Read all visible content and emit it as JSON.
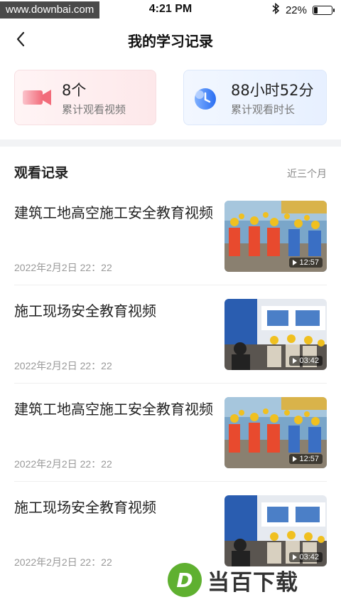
{
  "status_bar": {
    "watermark": "www.downbai.com",
    "time": "4:21 PM",
    "battery_percent": "22%",
    "battery_level": 0.22,
    "icons": [
      "bluetooth-icon",
      "battery-icon"
    ]
  },
  "nav": {
    "title": "我的学习记录",
    "back_icon": "chevron-left-icon"
  },
  "stats": {
    "videos": {
      "value": "8个",
      "label": "累计观看视频",
      "icon": "video-camera-icon",
      "accent": "#f26b7a"
    },
    "hours": {
      "value": "88小时52分",
      "label": "累计观看时长",
      "icon": "clock-icon",
      "accent": "#3b7cf6"
    }
  },
  "records_section": {
    "title": "观看记录",
    "filter": "近三个月",
    "items": [
      {
        "title": "建筑工地高空施工安全教育视频",
        "time": "2022年2月2日  22：22",
        "duration": "12:57",
        "thumb": "construction-workers-outdoor"
      },
      {
        "title": "施工现场安全教育视频",
        "time": "2022年2月2日  22：22",
        "duration": "03:42",
        "thumb": "workers-classroom"
      },
      {
        "title": "建筑工地高空施工安全教育视频",
        "time": "2022年2月2日  22：22",
        "duration": "12:57",
        "thumb": "construction-workers-outdoor"
      },
      {
        "title": "施工现场安全教育视频",
        "time": "2022年2月2日  22：22",
        "duration": "03:42",
        "thumb": "workers-classroom"
      }
    ]
  },
  "bottom_watermark": {
    "logo_letter": "D",
    "text": "当百下载",
    "color": "#5fb030"
  }
}
